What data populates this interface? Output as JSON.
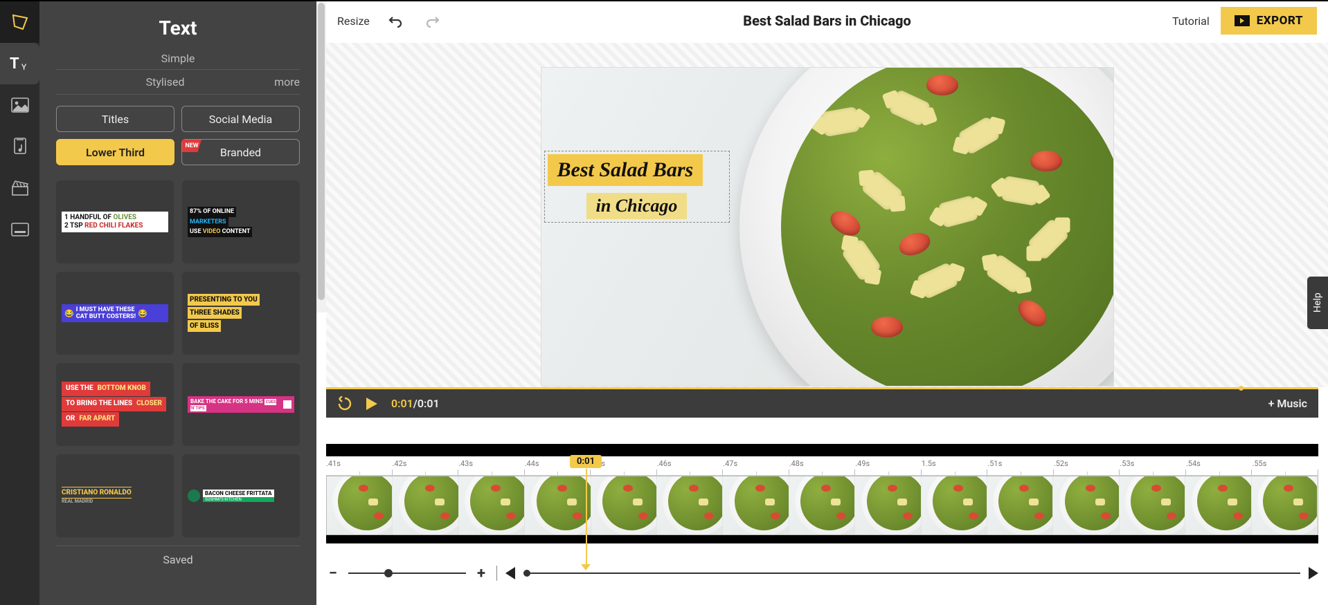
{
  "colors": {
    "accent": "#f3c94b",
    "dark": "#3c3c3c",
    "panel": "#434343"
  },
  "rail": {
    "items": [
      "logo",
      "text",
      "image",
      "audio",
      "scene",
      "caption"
    ]
  },
  "panel": {
    "title": "Text",
    "tab_simple": "Simple",
    "tab_stylised": "Stylised",
    "tab_more": "more",
    "pills": {
      "titles": "Titles",
      "social": "Social Media",
      "lower_third": "Lower Third",
      "branded": "Branded",
      "branded_badge": "NEW"
    },
    "thumbs": {
      "t1_l1a": "1 HANDFUL OF ",
      "t1_l1b": "OLIVES",
      "t1_l2a": "2 TSP ",
      "t1_l2b": "RED CHILI FLAKES",
      "t2_l1": "87% OF ONLINE",
      "t2_l2a": "MARKETERS",
      "t2_l3a": "USE ",
      "t2_l3b": "VIDEO",
      "t2_l3c": " CONTENT",
      "t3_l1": "I MUST HAVE THESE",
      "t3_l2": "CAT BUTT COSTERS!",
      "t4_l1": "PRESENTING TO YOU",
      "t4_l2": "THREE SHADES",
      "t4_l3": "OF BLISS",
      "t5_l1a": "USE THE ",
      "t5_l1b": "BOTTOM KNOB",
      "t5_l2a": "TO BRING THE LINES ",
      "t5_l2b": "CLOSER",
      "t5_l3a": "OR ",
      "t5_l3b": "FAR APART",
      "t6_main": "BAKE THE CAKE FOR 5 MINS",
      "t6_tag": "CUES 'N' TIPS",
      "t7_name": "CRISTIANO RONALDO",
      "t7_sub": "REAL MADRID",
      "t8_main": "BACON CHEESE FRITTATA",
      "t8_sub": "SUSHMI'S KITCHEN"
    },
    "saved": "Saved"
  },
  "topbar": {
    "resize": "Resize",
    "title": "Best Salad Bars in Chicago",
    "tutorial": "Tutorial",
    "export": "EXPORT"
  },
  "canvas": {
    "overlay_line1": "Best Salad Bars",
    "overlay_line2": "in Chicago"
  },
  "player": {
    "current": "0:01",
    "sep": " / ",
    "duration": "0:01",
    "add_music": "+ Music"
  },
  "timeline": {
    "playhead": "0:01",
    "ticks": [
      ".41s",
      ".42s",
      ".43s",
      ".44s",
      ".45s",
      ".46s",
      ".47s",
      ".48s",
      ".49s",
      "1.5s",
      ".51s",
      ".52s",
      ".53s",
      ".54s",
      ".55s"
    ]
  },
  "help": "Help"
}
